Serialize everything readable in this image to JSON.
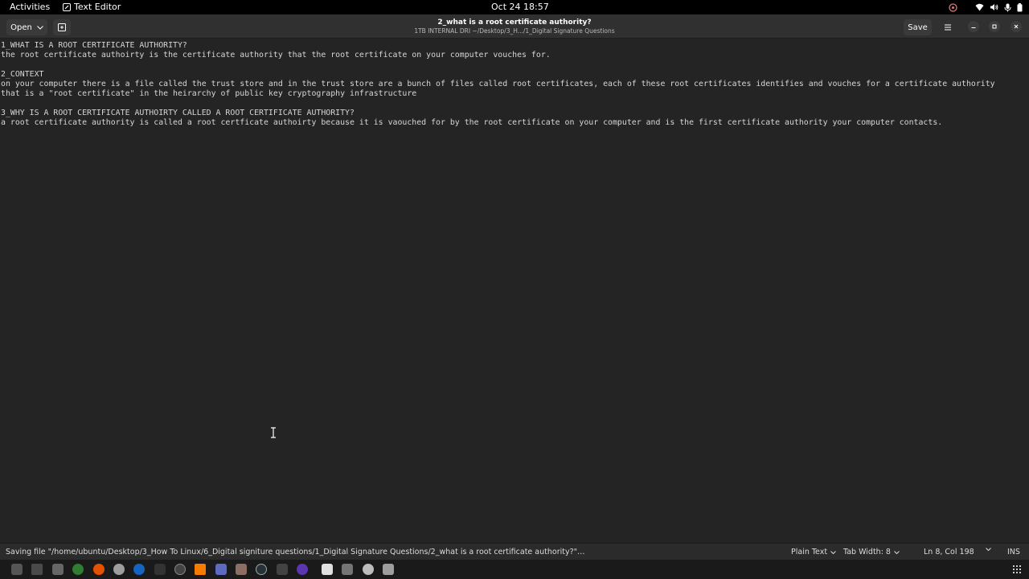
{
  "topbar": {
    "activities": "Activities",
    "app_name": "Text Editor",
    "clock": "Oct 24  18:57"
  },
  "headerbar": {
    "open_label": "Open",
    "save_label": "Save",
    "title": "2_what is a root certificate authority?",
    "subtitle": "1TB INTERNAL DRI ~/Desktop/3_H.../1_Digital Signature Questions"
  },
  "editor": {
    "lines": [
      "1_WHAT IS A ROOT CERTIFICATE AUTHORITY?",
      "the root certificate authoirty is the certificate authority that the root certificate on your computer vouches for.",
      "",
      "2_CONTEXT",
      "on your computer there is a file called the trust store and in the trust store are a bunch of files called root certificates, each of these root certificates identifies and vouches for a certificate authority",
      "that is a \"root certificate\" in the heirarchy of public key cryptography infrastructure",
      "",
      "3_WHY IS A ROOT CERTIFICATE AUTHOIRTY CALLED A ROOT CERTIFICATE AUTHORITY?",
      "a root certificate authority is called a root certficate authoirty because it is vaouched for by the root certificate on your computer and is the first certificate authority your computer contacts."
    ]
  },
  "statusbar": {
    "message": "Saving file \"/home/ubuntu/Desktop/3_How To Linux/6_Digital signiture questions/1_Digital Signature Questions/2_what is a root certificate authority?\"…",
    "language": "Plain Text",
    "tab_width": "Tab Width: 8",
    "position": "Ln 8, Col 198",
    "mode": "INS"
  },
  "colors": {
    "background": "#242424",
    "topbar": "#000000",
    "headerbar": "#303030",
    "text": "#d6d6d6"
  },
  "dock_icons": [
    "files-icon",
    "screenshot-icon",
    "folder-icon",
    "chrome-icon",
    "firefox-icon",
    "settings-icon",
    "steam-icon",
    "terminal-icon",
    "software-icon",
    "vlc-icon",
    "vscode-icon",
    "gimp-icon",
    "obs-icon",
    "calculator-icon",
    "chat-icon",
    "text-editor-icon",
    "notes-icon",
    "disk-icon",
    "archive-icon"
  ]
}
